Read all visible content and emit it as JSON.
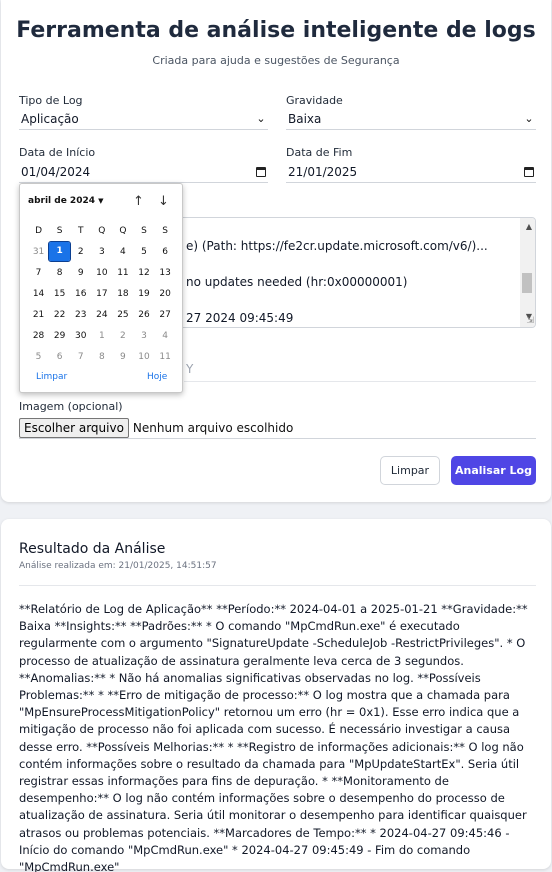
{
  "header": {
    "title": "Ferramenta de análise inteligente de logs",
    "subtitle": "Criada para ajuda e sugestões de Segurança"
  },
  "form": {
    "log_type": {
      "label": "Tipo de Log",
      "value": "Aplicação"
    },
    "severity": {
      "label": "Gravidade",
      "value": "Baixa"
    },
    "start_date": {
      "label": "Data de Início",
      "value": "01/04/2024"
    },
    "end_date": {
      "label": "Data de Fim",
      "value": "21/01/2025"
    },
    "log_text_visible_lines": [
      "e) (Path: https://fe2cr.update.microsoft.com/v6/)...",
      "no updates needed (hr:0x00000001)",
      "27 2024 09:45:49"
    ],
    "token_field_partial": "Y",
    "image": {
      "label": "Imagem (opcional)",
      "button": "Escolher arquivo",
      "status": "Nenhum arquivo escolhido"
    },
    "clear_button": "Limpar",
    "analyze_button": "Analisar Log"
  },
  "datepicker": {
    "month": "abril de 2024",
    "weekdays": [
      "D",
      "S",
      "T",
      "Q",
      "Q",
      "S",
      "S"
    ],
    "weeks": [
      [
        "31",
        "1",
        "2",
        "3",
        "4",
        "5",
        "6"
      ],
      [
        "7",
        "8",
        "9",
        "10",
        "11",
        "12",
        "13"
      ],
      [
        "14",
        "15",
        "16",
        "17",
        "18",
        "19",
        "20"
      ],
      [
        "21",
        "22",
        "23",
        "24",
        "25",
        "26",
        "27"
      ],
      [
        "28",
        "29",
        "30",
        "1",
        "2",
        "3",
        "4"
      ],
      [
        "5",
        "6",
        "7",
        "8",
        "9",
        "10",
        "11"
      ]
    ],
    "selected": "1",
    "clear": "Limpar",
    "today": "Hoje"
  },
  "result": {
    "title": "Resultado da Análise",
    "meta": "Análise realizada em: 21/01/2025, 14:51:57",
    "body": "**Relatório de Log de Aplicação** **Período:** 2024-04-01 a 2025-01-21 **Gravidade:** Baixa **Insights:** **Padrões:** * O comando \"MpCmdRun.exe\" é executado regularmente com o argumento \"SignatureUpdate -ScheduleJob -RestrictPrivileges\". * O processo de atualização de assinatura geralmente leva cerca de 3 segundos. **Anomalias:** * Não há anomalias significativas observadas no log. **Possíveis Problemas:** * **Erro de mitigação de processo:** O log mostra que a chamada para \"MpEnsureProcessMitigationPolicy\" retornou um erro (hr = 0x1). Esse erro indica que a mitigação de processo não foi aplicada com sucesso. É necessário investigar a causa desse erro. **Possíveis Melhorias:** * **Registro de informações adicionais:** O log não contém informações sobre o resultado da chamada para \"MpUpdateStartEx\". Seria útil registrar essas informações para fins de depuração. * **Monitoramento de desempenho:** O log não contém informações sobre o desempenho do processo de atualização de assinatura. Seria útil monitorar o desempenho para identificar quaisquer atrasos ou problemas potenciais. **Marcadores de Tempo:** * 2024-04-27 09:45:46 - Início do comando \"MpCmdRun.exe\" * 2024-04-27 09:45:49 - Fim do comando \"MpCmdRun.exe\""
  },
  "colors": {
    "accent": "#4f46e5",
    "datepicker_selected": "#1a73e8",
    "background": "#eff1f5"
  }
}
